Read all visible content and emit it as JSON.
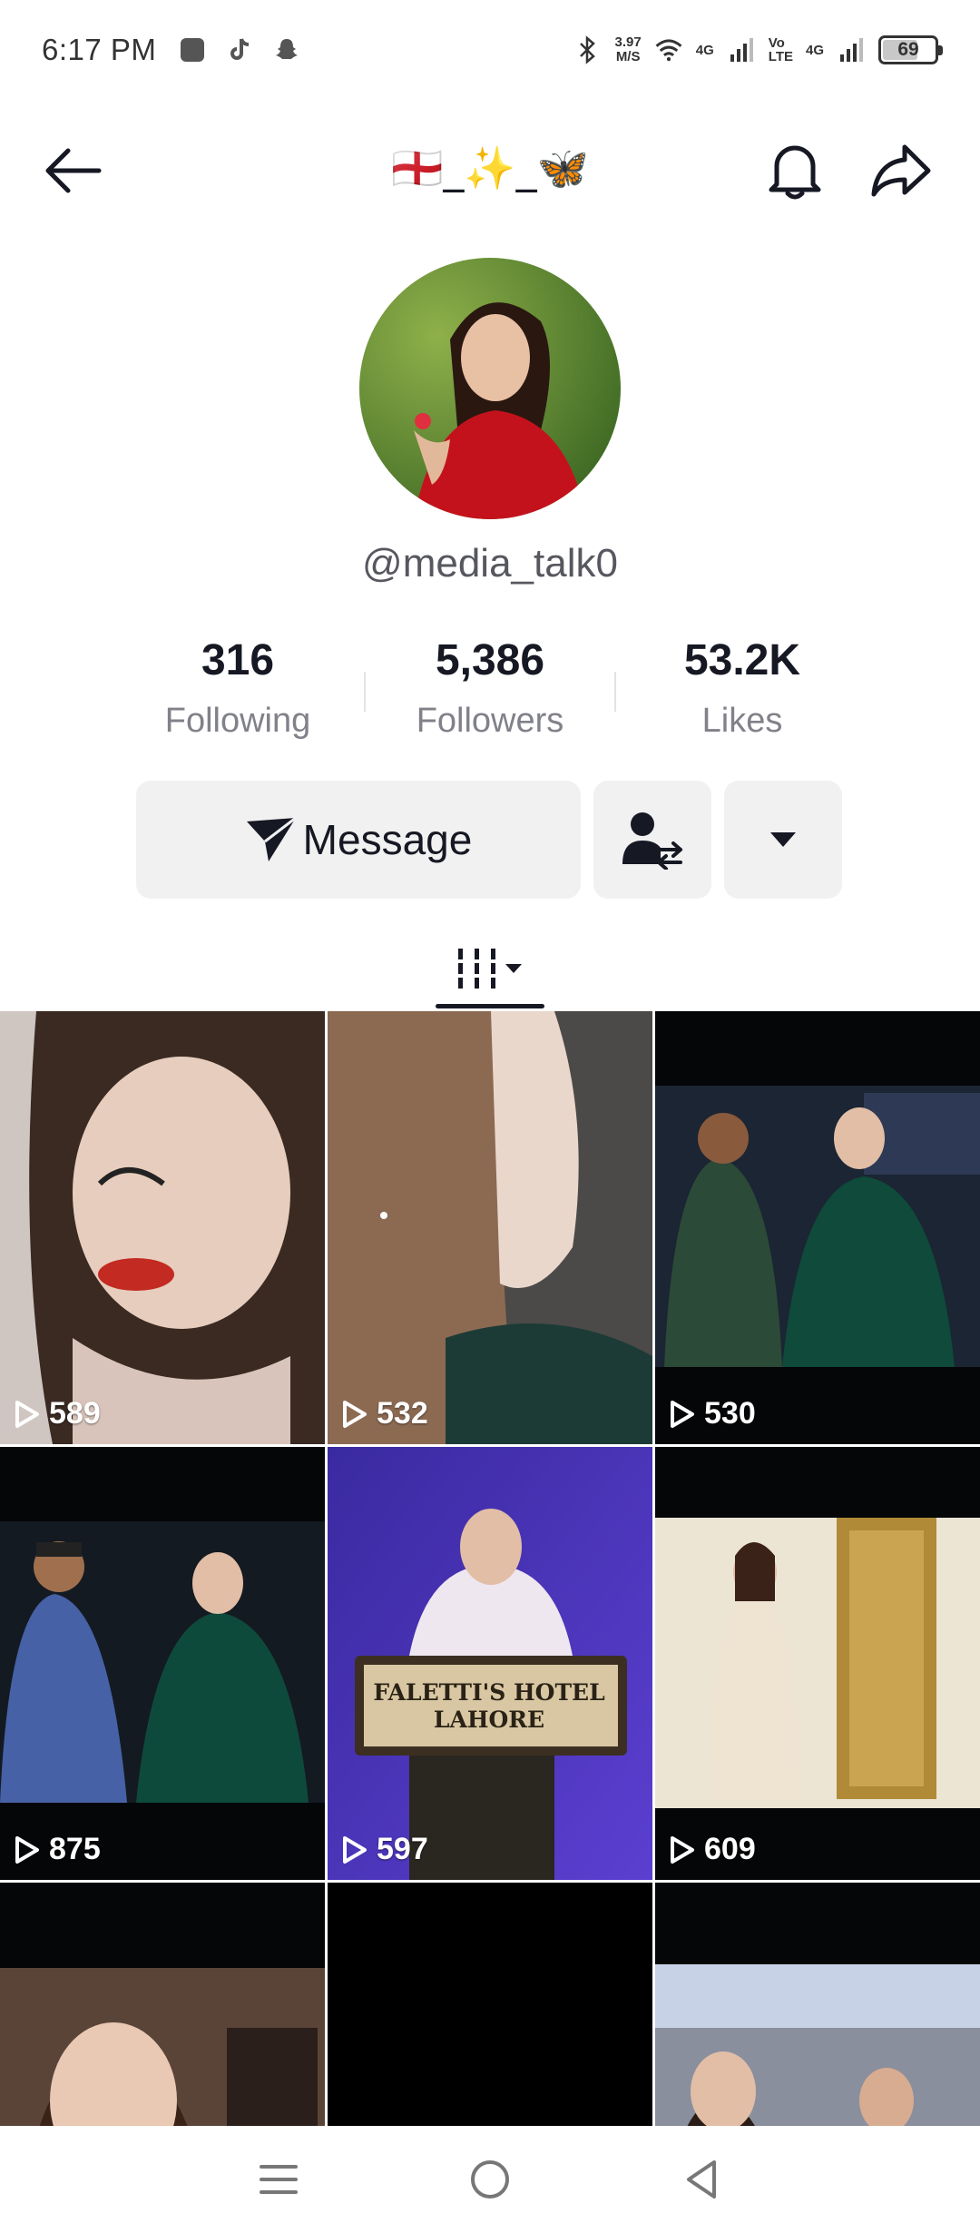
{
  "status_bar": {
    "time": "6:17 PM",
    "speed_value": "3.97",
    "speed_unit": "M/S",
    "net1": "4G",
    "volte_top": "Vo",
    "volte_bottom": "LTE",
    "net2": "4G",
    "battery": "69"
  },
  "header": {
    "title": "🏴󠁧󠁢󠁥󠁮󠁧󠁿_✨_🦋",
    "back_icon": "arrow-left-icon",
    "bell_icon": "bell-icon",
    "share_icon": "share-arrow-icon"
  },
  "profile": {
    "username": "@media_talk0"
  },
  "stats": [
    {
      "value": "316",
      "label": "Following"
    },
    {
      "value": "5,386",
      "label": "Followers"
    },
    {
      "value": "53.2K",
      "label": "Likes"
    }
  ],
  "buttons": {
    "message_label": "Message"
  },
  "videos": [
    {
      "views": "589"
    },
    {
      "views": "532"
    },
    {
      "views": "530"
    },
    {
      "views": "875"
    },
    {
      "views": "597"
    },
    {
      "views": "609"
    },
    {
      "views": ""
    },
    {
      "views": ""
    },
    {
      "views": ""
    }
  ],
  "thumb_text": {
    "sign_line1": "FALETTI'S HOTEL",
    "sign_line2": "LAHORE"
  },
  "colors": {
    "accent": "#161823",
    "button_bg": "#f1f1f2",
    "muted_text": "#808189"
  }
}
